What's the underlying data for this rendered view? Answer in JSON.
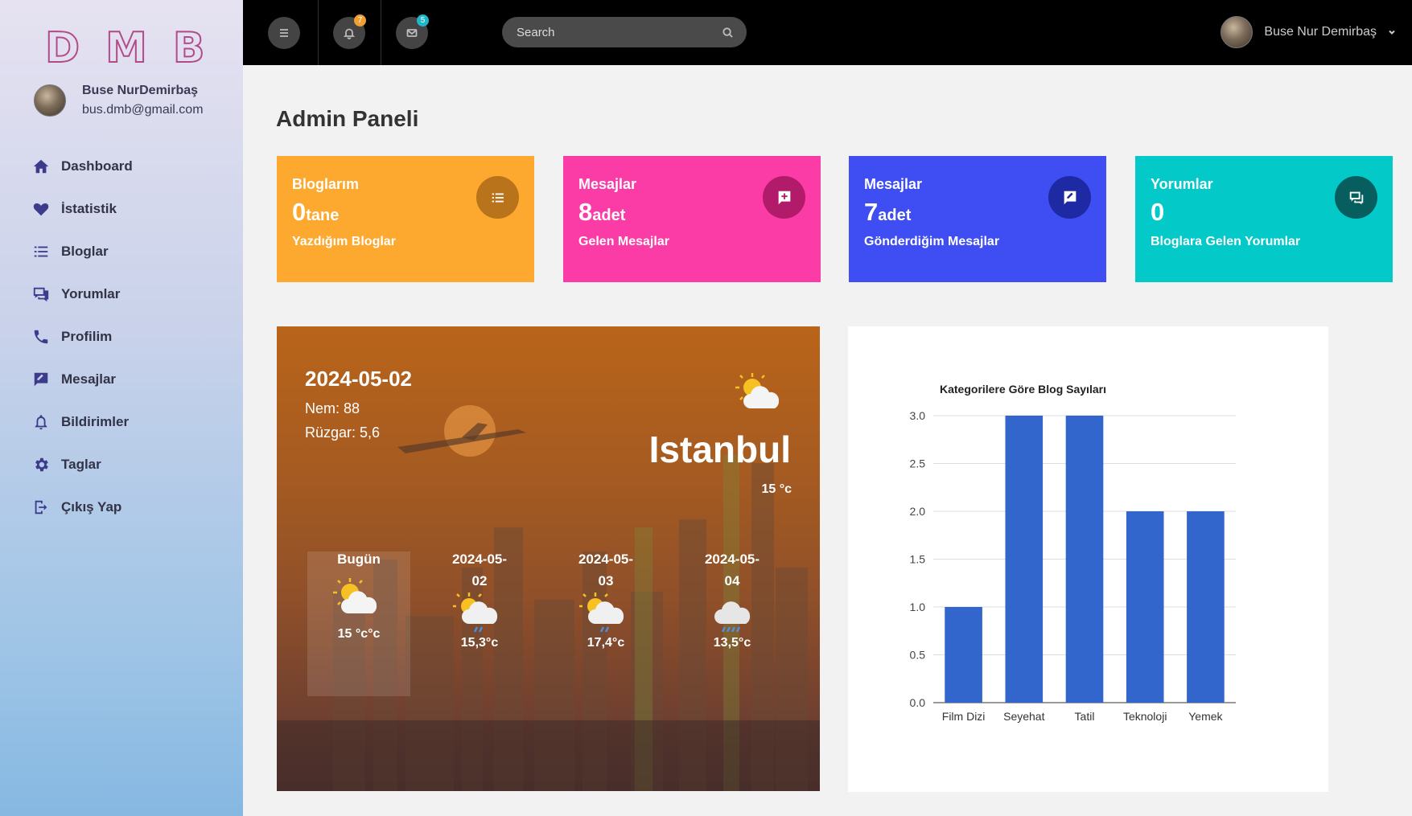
{
  "brand": {
    "letters": [
      "D",
      "M",
      "B"
    ],
    "color": "#b24b8a"
  },
  "sidebar": {
    "user": {
      "name": "Buse NurDemirbaş",
      "email": "bus.dmb@gmail.com"
    },
    "items": [
      {
        "label": "Dashboard",
        "icon": "home-icon"
      },
      {
        "label": "İstatistik",
        "icon": "heart-icon"
      },
      {
        "label": "Bloglar",
        "icon": "list-icon"
      },
      {
        "label": "Yorumlar",
        "icon": "comments-icon"
      },
      {
        "label": "Profilim",
        "icon": "phone-icon"
      },
      {
        "label": "Mesajlar",
        "icon": "message-edit-icon"
      },
      {
        "label": "Bildirimler",
        "icon": "bell-icon"
      },
      {
        "label": "Taglar",
        "icon": "gear-icon"
      },
      {
        "label": "Çıkış Yap",
        "icon": "logout-icon"
      }
    ]
  },
  "topbar": {
    "notification_count": "7",
    "message_count": "5",
    "search_placeholder": "Search",
    "user_name": "Buse Nur Demirbaş",
    "colors": {
      "notification_badge": "#f0a030",
      "message_badge": "#1fb8c9"
    }
  },
  "page": {
    "title": "Admin Paneli"
  },
  "cards": [
    {
      "title": "Bloglarım",
      "value": "0",
      "unit": "tane",
      "subtitle": "Yazdığım Bloglar",
      "icon": "list-icon",
      "bg": "#fda82f",
      "icon_bg": "#b8731b"
    },
    {
      "title": "Mesajlar",
      "value": "8",
      "unit": "adet",
      "subtitle": "Gelen Mesajlar",
      "icon": "message-plus-icon",
      "bg": "#fc3ca6",
      "icon_bg": "#b21a6a"
    },
    {
      "title": "Mesajlar",
      "value": "7",
      "unit": "adet",
      "subtitle": "Gönderdiğim Mesajlar",
      "icon": "message-edit-icon",
      "bg": "#3f4ef2",
      "icon_bg": "#1d2aa3"
    },
    {
      "title": "Yorumlar",
      "value": "0",
      "unit": "",
      "subtitle": "Bloglara Gelen Yorumlar",
      "icon": "comments-icon",
      "bg": "#03c9c9",
      "icon_bg": "#075e5e"
    }
  ],
  "weather": {
    "date": "2024-05-02",
    "humidity": "Nem: 88",
    "wind": "Rüzgar: 5,6",
    "city": "Istanbul",
    "temp": "15 °c",
    "icon": "partly-cloudy-icon",
    "forecast": [
      {
        "date_line1": "Bugün",
        "date_line2": "",
        "temp": "15 °c°c",
        "icon": "partly-cloudy-icon"
      },
      {
        "date_line1": "2024-05-",
        "date_line2": "02",
        "temp": "15,3°c",
        "icon": "sun-cloud-rain-icon"
      },
      {
        "date_line1": "2024-05-",
        "date_line2": "03",
        "temp": "17,4°c",
        "icon": "sun-cloud-rain-icon"
      },
      {
        "date_line1": "2024-05-",
        "date_line2": "04",
        "temp": "13,5°c",
        "icon": "cloud-rain-icon"
      }
    ]
  },
  "chart_data": {
    "type": "bar",
    "title": "Kategorilere Göre Blog Sayıları",
    "categories": [
      "Film Dizi",
      "Seyehat",
      "Tatil",
      "Teknoloji",
      "Yemek"
    ],
    "values": [
      1,
      3,
      3,
      2,
      2
    ],
    "ylim": [
      0,
      3
    ],
    "yticks": [
      "0.0",
      "0.5",
      "1.0",
      "1.5",
      "2.0",
      "2.5",
      "3.0"
    ],
    "xlabel": "",
    "ylabel": "",
    "grid": true,
    "legend": "none",
    "color": "#3366cc"
  }
}
